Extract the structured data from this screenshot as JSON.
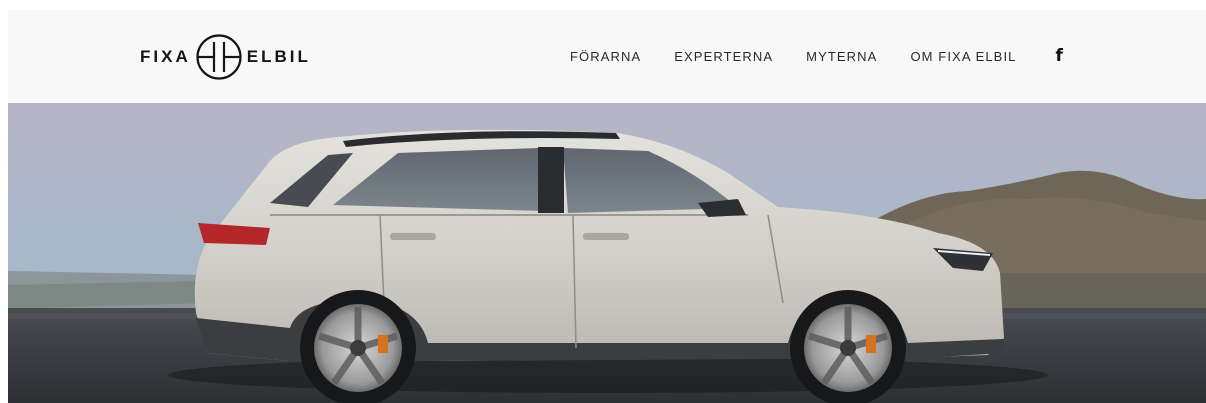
{
  "header": {
    "logo": {
      "left_word": "FIXA",
      "right_word": "ELBIL"
    },
    "nav": [
      {
        "label": "FÖRARNA"
      },
      {
        "label": "EXPERTERNA"
      },
      {
        "label": "MYTERNA"
      },
      {
        "label": "OM FIXA ELBIL"
      }
    ],
    "social": {
      "icon": "facebook-icon",
      "glyph": "f"
    }
  },
  "hero": {
    "image": "white-electric-suv-on-mountain-overlook",
    "colors": {
      "sky_top": "#b8b6c6",
      "sky_bottom": "#9eb4c8",
      "ground": "#3b3d42",
      "car_body": "#d2d0c8"
    }
  }
}
